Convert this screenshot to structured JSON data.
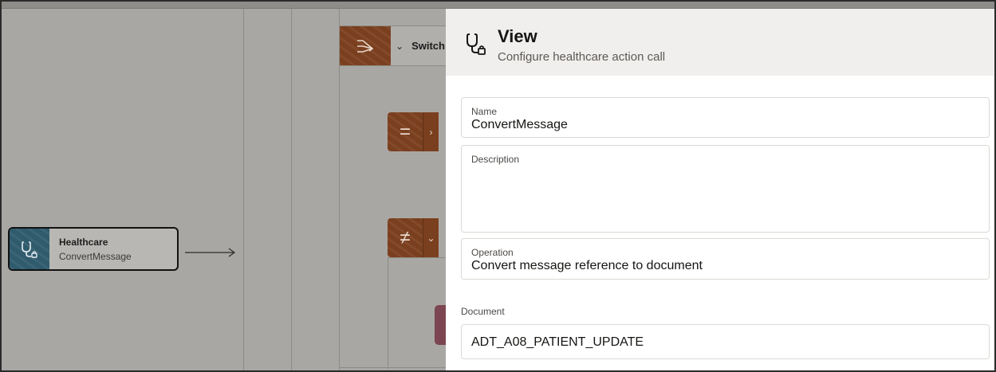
{
  "canvas": {
    "switch_node": {
      "label": "Switch",
      "icon": "switch-icon"
    },
    "branches": [
      {
        "operator": "=",
        "icon": "equals-icon"
      },
      {
        "operator": "≠",
        "icon": "not-equal-icon"
      }
    ],
    "healthcare_node": {
      "title": "Healthcare",
      "subtitle": "ConvertMessage",
      "icon": "stethoscope-icon"
    }
  },
  "panel": {
    "title": "View",
    "subtitle": "Configure healthcare action call",
    "icon": "stethoscope-icon",
    "fields": {
      "name": {
        "label": "Name",
        "value": "ConvertMessage"
      },
      "description": {
        "label": "Description",
        "value": ""
      },
      "operation": {
        "label": "Operation",
        "value": "Convert message reference to document"
      },
      "document": {
        "label": "Document",
        "value": "ADT_A08_PATIENT_UPDATE"
      }
    }
  },
  "colors": {
    "action_tile": "#7a3f1e",
    "healthcare_tile": "#2f5b6d",
    "panel_header": "#f1efed"
  }
}
